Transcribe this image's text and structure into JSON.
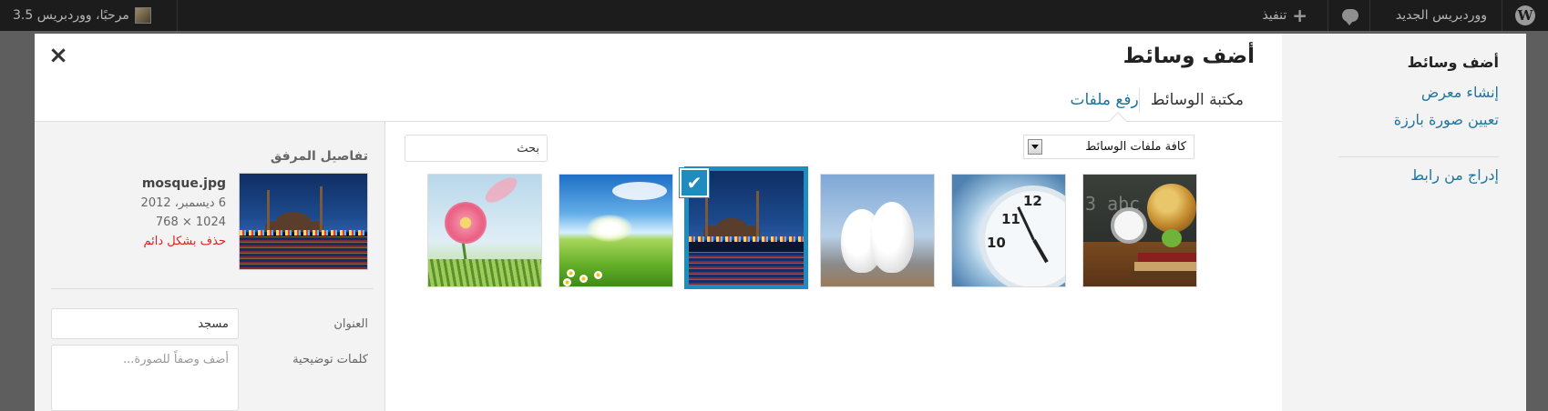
{
  "admin_bar": {
    "site_name": "ووردبريس الجديد",
    "new_label": "تنفيذ",
    "greeting": "مرحبًا، ووردبريس 3.5"
  },
  "menu": {
    "title": "أضف وسائط",
    "create_gallery": "إنشاء معرض",
    "set_featured": "تعيين صورة بارزة",
    "insert_from_url": "إدراج من رابط"
  },
  "frame": {
    "title": "أضف وسائط",
    "close_symbol": "×",
    "tabs": [
      {
        "label": "رفع ملفات"
      },
      {
        "label": "مكتبة الوسائط"
      }
    ]
  },
  "toolbar": {
    "filter_selected": "كافة ملفات الوسائط",
    "search_placeholder": "بحث"
  },
  "attachments": [
    {
      "icon": "school-supplies-image",
      "selected": false
    },
    {
      "icon": "clock-image",
      "selected": false
    },
    {
      "icon": "doves-image",
      "selected": false
    },
    {
      "icon": "mosque-image",
      "selected": true
    },
    {
      "icon": "meadow-image",
      "selected": false
    },
    {
      "icon": "flower-image",
      "selected": false
    }
  ],
  "check_mark": "✔",
  "details": {
    "heading": "تفاصيل المرفق",
    "filename": "mosque.jpg",
    "date": "6 ديسمبر، 2012",
    "dimensions": "1024 × 768",
    "delete_label": "حذف بشكل دائم",
    "title_label": "العنوان",
    "title_value": "مسجد",
    "caption_label": "كلمات توضيحية",
    "caption_placeholder": "أضف وصفاً للصورة..."
  },
  "colors": {
    "accent": "#21759b",
    "selection": "#1e8cbe",
    "danger": "#e02020",
    "admin_bar": "#1c1c1c"
  }
}
